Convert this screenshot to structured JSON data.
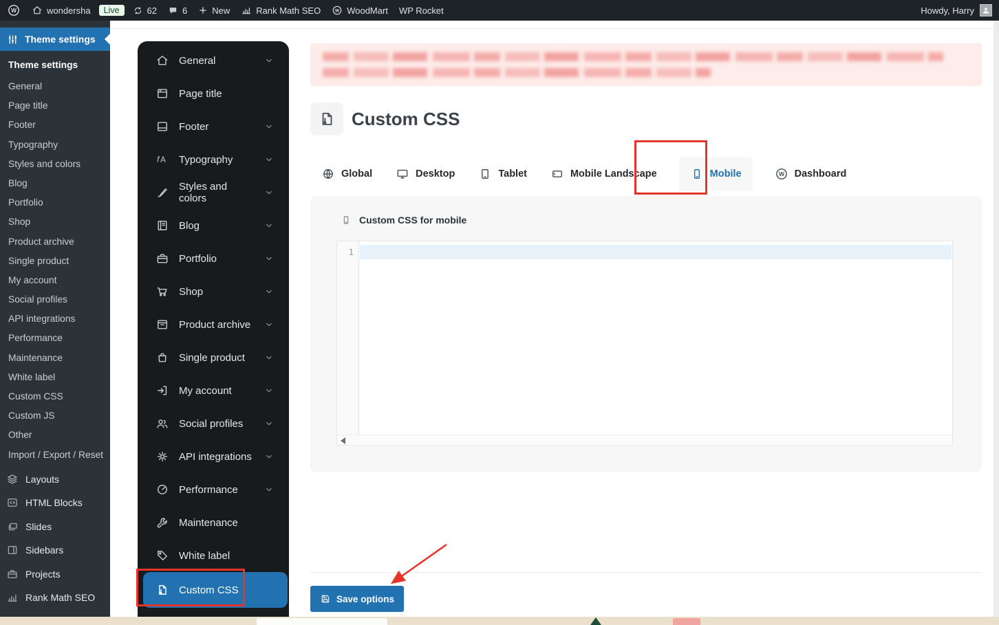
{
  "admin_bar": {
    "site_name": "wondersha",
    "live_badge": "Live",
    "update_count": "62",
    "comment_count": "6",
    "new_label": "New",
    "rank_math_label": "Rank Math SEO",
    "woodmart_label": "WoodMart",
    "wp_rocket_label": "WP Rocket",
    "howdy": "Howdy, Harry"
  },
  "wp_sidebar": {
    "header": "Theme settings",
    "submenu_title": "Theme settings",
    "items": [
      "General",
      "Page title",
      "Footer",
      "Typography",
      "Styles and colors",
      "Blog",
      "Portfolio",
      "Shop",
      "Product archive",
      "Single product",
      "My account",
      "Social profiles",
      "API integrations",
      "Performance",
      "Maintenance",
      "White label",
      "Custom CSS",
      "Custom JS",
      "Other",
      "Import / Export / Reset"
    ],
    "tools": [
      "Layouts",
      "HTML Blocks",
      "Slides",
      "Sidebars",
      "Projects",
      "Rank Math SEO"
    ]
  },
  "theme_nav": {
    "items": [
      {
        "label": "General",
        "chevron": true,
        "active": false
      },
      {
        "label": "Page title",
        "chevron": false,
        "active": false
      },
      {
        "label": "Footer",
        "chevron": true,
        "active": false
      },
      {
        "label": "Typography",
        "chevron": true,
        "active": false
      },
      {
        "label": "Styles and colors",
        "chevron": true,
        "active": false
      },
      {
        "label": "Blog",
        "chevron": true,
        "active": false
      },
      {
        "label": "Portfolio",
        "chevron": true,
        "active": false
      },
      {
        "label": "Shop",
        "chevron": true,
        "active": false
      },
      {
        "label": "Product archive",
        "chevron": true,
        "active": false
      },
      {
        "label": "Single product",
        "chevron": true,
        "active": false
      },
      {
        "label": "My account",
        "chevron": true,
        "active": false
      },
      {
        "label": "Social profiles",
        "chevron": true,
        "active": false
      },
      {
        "label": "API integrations",
        "chevron": true,
        "active": false
      },
      {
        "label": "Performance",
        "chevron": true,
        "active": false
      },
      {
        "label": "Maintenance",
        "chevron": false,
        "active": false
      },
      {
        "label": "White label",
        "chevron": false,
        "active": false
      },
      {
        "label": "Custom CSS",
        "chevron": false,
        "active": true
      }
    ]
  },
  "main": {
    "page_title": "Custom CSS",
    "notice_redacted": true,
    "tabs": [
      {
        "label": "Global",
        "active": false
      },
      {
        "label": "Desktop",
        "active": false
      },
      {
        "label": "Tablet",
        "active": false
      },
      {
        "label": "Mobile Landscape",
        "active": false
      },
      {
        "label": "Mobile",
        "active": true
      },
      {
        "label": "Dashboard",
        "active": false
      }
    ],
    "editor": {
      "label": "Custom CSS for mobile",
      "line_number": "1",
      "content": ""
    },
    "save_button_label": "Save options"
  },
  "colors": {
    "accent_blue": "#2271b1",
    "annotation_red": "#e5352b",
    "notice_bg": "#fdecea",
    "active_line": "#e8f2fb",
    "admin_bar_bg": "#1d2327",
    "sidebar_bg": "#2c3338",
    "theme_panel_bg": "#181b1e"
  }
}
